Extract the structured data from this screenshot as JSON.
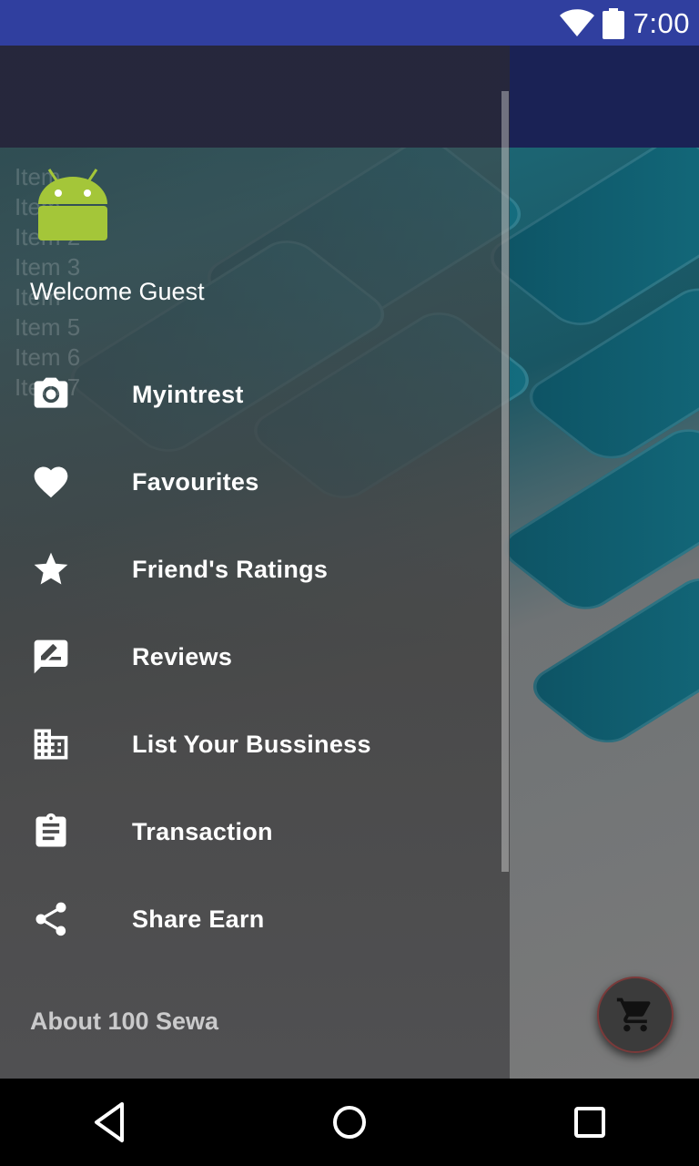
{
  "status_bar": {
    "time": "7:00"
  },
  "drawer": {
    "ghost_items": [
      "Item",
      "Item",
      "Item 2",
      "Item 3",
      "Item",
      "Item 5",
      "Item 6",
      "Item 7"
    ],
    "welcome_text": "Welcome Guest",
    "menu": [
      {
        "label": "Myintrest",
        "icon": "camera-icon"
      },
      {
        "label": "Favourites",
        "icon": "heart-icon"
      },
      {
        "label": "Friend's Ratings",
        "icon": "star-icon"
      },
      {
        "label": "Reviews",
        "icon": "rate-review-icon"
      },
      {
        "label": "List Your Bussiness",
        "icon": "business-icon"
      },
      {
        "label": "Transaction",
        "icon": "assignment-icon"
      },
      {
        "label": "Share Earn",
        "icon": "share-icon"
      }
    ],
    "footer": "About 100 Sewa"
  },
  "fab": {
    "icon": "shopping-cart-icon"
  },
  "nav_bar": {
    "back": "back-icon",
    "home": "home-icon",
    "recents": "recents-icon"
  },
  "colors": {
    "status_bar": "#303f9f",
    "appbar": "#1a2255",
    "nav_bar": "#000000"
  }
}
